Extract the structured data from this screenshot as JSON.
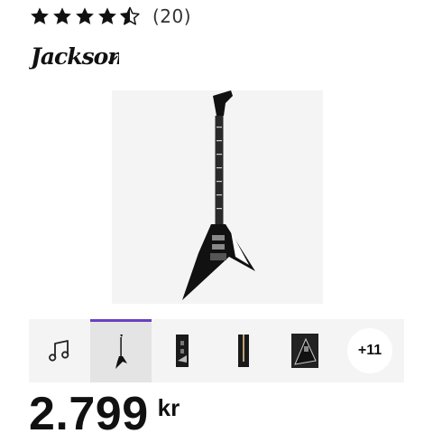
{
  "rating": {
    "stars": 4.5,
    "count_label": "(20)"
  },
  "brand": {
    "name": "Jackson"
  },
  "thumbnails": {
    "items": [
      {
        "icon": "music-note-icon"
      },
      {
        "icon": "guitar-full-icon"
      },
      {
        "icon": "guitar-body-icon"
      },
      {
        "icon": "guitar-headstock-icon"
      },
      {
        "icon": "guitar-body-angle-icon"
      }
    ],
    "more_label": "+11"
  },
  "price": {
    "amount": "2.799",
    "currency": "kr"
  },
  "colors": {
    "accent": "#6a3fc3",
    "strip_bg": "#f4f4f4"
  }
}
